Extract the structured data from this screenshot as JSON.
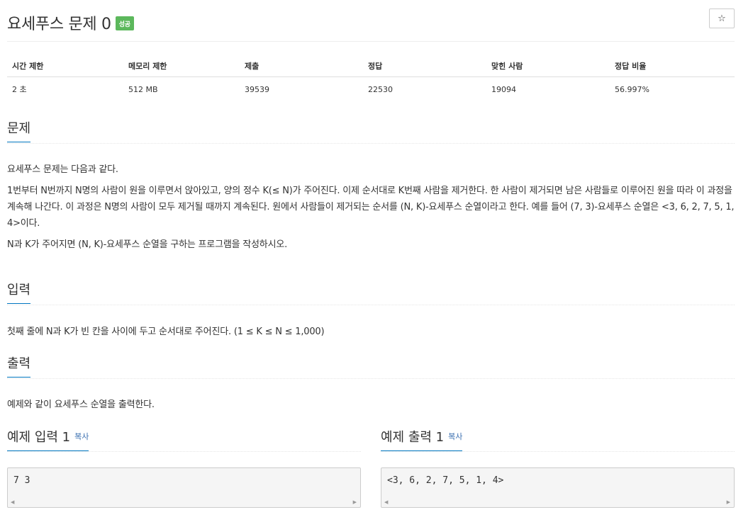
{
  "problem": {
    "title": "요세푸스 문제 0",
    "badge": "성공",
    "star_icon": "☆"
  },
  "info_table": {
    "headers": [
      "시간 제한",
      "메모리 제한",
      "제출",
      "정답",
      "맞힌 사람",
      "정답 비율"
    ],
    "values": [
      "2 초",
      "512 MB",
      "39539",
      "22530",
      "19094",
      "56.997%"
    ]
  },
  "sections": {
    "description_title": "문제",
    "description": [
      "요세푸스 문제는 다음과 같다.",
      "1번부터 N번까지 N명의 사람이 원을 이루면서 앉아있고, 양의 정수 K(≤ N)가 주어진다. 이제 순서대로 K번째 사람을 제거한다. 한 사람이 제거되면 남은 사람들로 이루어진 원을 따라 이 과정을 계속해 나간다. 이 과정은 N명의 사람이 모두 제거될 때까지 계속된다. 원에서 사람들이 제거되는 순서를 (N, K)-요세푸스 순열이라고 한다. 예를 들어 (7, 3)-요세푸스 순열은 <3, 6, 2, 7, 5, 1, 4>이다.",
      "N과 K가 주어지면 (N, K)-요세푸스 순열을 구하는 프로그램을 작성하시오."
    ],
    "input_title": "입력",
    "input": "첫째 줄에 N과 K가 빈 칸을 사이에 두고 순서대로 주어진다. (1 ≤ K ≤ N ≤ 1,000)",
    "output_title": "출력",
    "output": "예제와 같이 요세푸스 순열을 출력한다."
  },
  "samples": {
    "input_title": "예제 입력 1",
    "input_copy": "복사",
    "input_value": "7 3",
    "output_title": "예제 출력 1",
    "output_copy": "복사",
    "output_value": "<3, 6, 2, 7, 5, 1, 4>"
  },
  "colors": {
    "success_badge": "#5cb85c",
    "accent_underline": "#0076c0",
    "link": "#3a6fb0"
  }
}
